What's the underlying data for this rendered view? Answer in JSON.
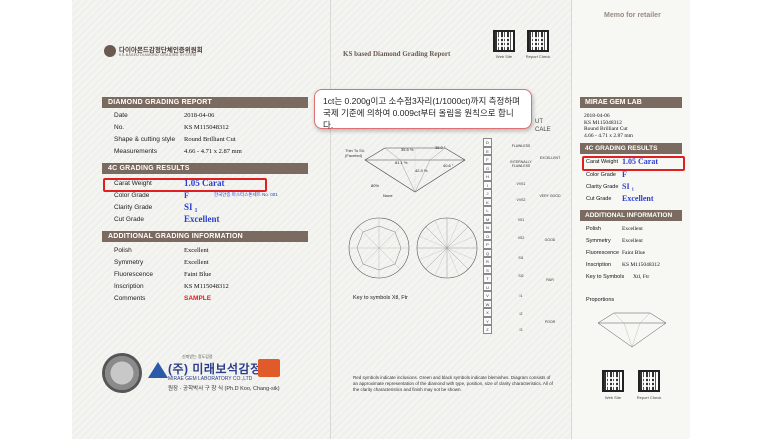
{
  "left": {
    "header_logo_text": "다이아몬드감정단체인증위원회",
    "header_logo_sub": "KS-BASED DIAMOND GRADING SYSTEM",
    "report_title": "DIAMOND GRADING REPORT",
    "report_rows": [
      {
        "label": "Date",
        "value": "2018-04-06"
      },
      {
        "label": "No.",
        "value": "KS M115048312"
      },
      {
        "label": "Shape & cutting style",
        "value": "Round Brilliant Cut"
      },
      {
        "label": "Measurements",
        "value": "4.66 - 4.71 x 2.87 mm"
      }
    ],
    "c4_title": "4C GRADING RESULTS",
    "c4_rows": [
      {
        "label": "Carat Weight",
        "value": "1.05 Carat"
      },
      {
        "label": "Color Grade",
        "value": "F"
      },
      {
        "label": "Clarity Grade",
        "value": "SI ₁"
      },
      {
        "label": "Cut Grade",
        "value": "Excellent"
      }
    ],
    "color_note": "한국안증 마스터스톤세트 No. 001",
    "additional_title": "ADDITIONAL GRADING INFORMATION",
    "additional_rows": [
      {
        "label": "Polish",
        "value": "Excellent"
      },
      {
        "label": "Symmetry",
        "value": "Excellent"
      },
      {
        "label": "Fluorescence",
        "value": "Faint Blue"
      },
      {
        "label": "Inscription",
        "value": "KS M115048312"
      },
      {
        "label": "Comments",
        "value": "SAMPLE"
      }
    ],
    "lab_small": "신뢰받는 정도감정",
    "lab_name_ko": "(주) 미래보석감정원",
    "lab_name_en": "MIRAE GEM LABORATORY CO.,LTD",
    "lab_director": "원장 · 공학박사 구 창 식 (Ph.D Koo, Chang-sik)"
  },
  "middle": {
    "report_header": "KS based Diamond Grading Report",
    "qr1_caption": "Web Site",
    "qr2_caption": "Report Check",
    "tooltip": "1ct는 0.200g이고 소수점3자리(1/1000ct)까지 측정하며 국제 기준에 의하여 0.009ct부터 올림을 원칙으로 합니다.",
    "scale_header_1": "UT",
    "scale_header_2": "CALE",
    "scale_letters": [
      "D",
      "E",
      "F",
      "G",
      "H",
      "I",
      "J",
      "K",
      "L",
      "M",
      "N",
      "O",
      "P",
      "Q",
      "R",
      "S",
      "T",
      "U",
      "V",
      "W",
      "X",
      "Y",
      "Z"
    ],
    "clarity_labels": [
      "FLAWLESS",
      "INTERNALLY FLAWLESS",
      "VVS1",
      "VVS2",
      "VS1",
      "VS2",
      "SI1",
      "SI2",
      "I1",
      "I2",
      "I3"
    ],
    "cut_labels": [
      "EXCELLENT",
      "VERY GOOD",
      "GOOD",
      "FAIR",
      "POOR"
    ],
    "table_label": "Thin To Sli. (Faceted)",
    "pct_1": "35.5 %",
    "pct_2": "35.0 °",
    "pct_3": "61.1 %",
    "pct_4": "42.3 %",
    "pct_5": "40.6 °",
    "pct_6": "80%",
    "culet_label": "None",
    "key_symbols": "Key to symbols  Xtl,  Ftr",
    "footnote": "Red symbols indicate inclusions. Green and black symbols indicate blemishes. Diagram consists of an approximate representation of the diamond with type, position, size of clarity characteristics. All of the clarity characteristics and finish may not be shown."
  },
  "right": {
    "memo": "Memo for retailer",
    "lab_title": "MIRAE GEM LAB",
    "info_lines": [
      "2018-04-06",
      "KS M115048312",
      "Round Brilliant Cut",
      "4.66 - 4.71 x 2.87 mm"
    ],
    "c4_title": "4C GRADING RESULTS",
    "c4_rows": [
      {
        "label": "Carat Weight",
        "value": "1.05 Carat"
      },
      {
        "label": "Color Grade",
        "value": "F"
      },
      {
        "label": "Clarity Grade",
        "value": "SI ₁"
      },
      {
        "label": "Cut Grade",
        "value": "Excellent"
      }
    ],
    "additional_title": "ADDITIONAL INFORMATION",
    "additional_rows": [
      {
        "label": "Polish",
        "value": "Excellent"
      },
      {
        "label": "Symmetry",
        "value": "Excellent"
      },
      {
        "label": "Fluorescence",
        "value": "Faint Blue"
      },
      {
        "label": "Inscription",
        "value": "KS M115048312"
      },
      {
        "label": "Key to Symbols",
        "value": "Xtl,  Ftr"
      }
    ],
    "proportions_label": "Proportions",
    "qr1_caption": "Web Site",
    "qr2_caption": "Report Check"
  },
  "colors": {
    "accent_bar": "#7a6a60",
    "highlight_red": "#e02020",
    "value_blue": "#2a3fd0"
  }
}
